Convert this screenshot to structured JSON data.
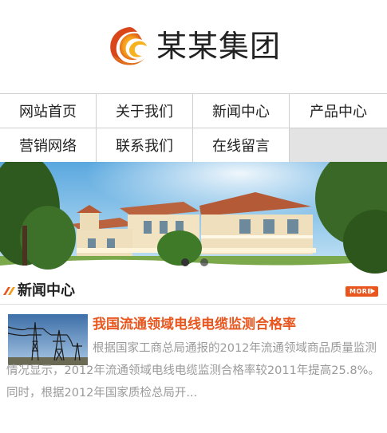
{
  "header": {
    "brand_name": "某某集团"
  },
  "nav": {
    "items": [
      {
        "label": "网站首页"
      },
      {
        "label": "关于我们"
      },
      {
        "label": "新闻中心"
      },
      {
        "label": "产品中心"
      },
      {
        "label": "营销网络"
      },
      {
        "label": "联系我们"
      },
      {
        "label": "在线留言"
      }
    ]
  },
  "banner": {
    "slide_count": 2,
    "active_slide": 1
  },
  "news_section": {
    "title": "新闻中心",
    "more_label": "MORE",
    "article": {
      "title": "我国流通领域电线电缆监测合格率",
      "summary": "根据国家工商总局通报的2012年流通领域商品质量监测情况显示，2012年流通领域电线电缆监测合格率较2011年提高25.8%。同时，根据2012年国家质检总局开..."
    }
  },
  "colors": {
    "accent": "#e8561e",
    "summary_text": "#9a9a9a",
    "nav_border": "#cfcfcf"
  }
}
